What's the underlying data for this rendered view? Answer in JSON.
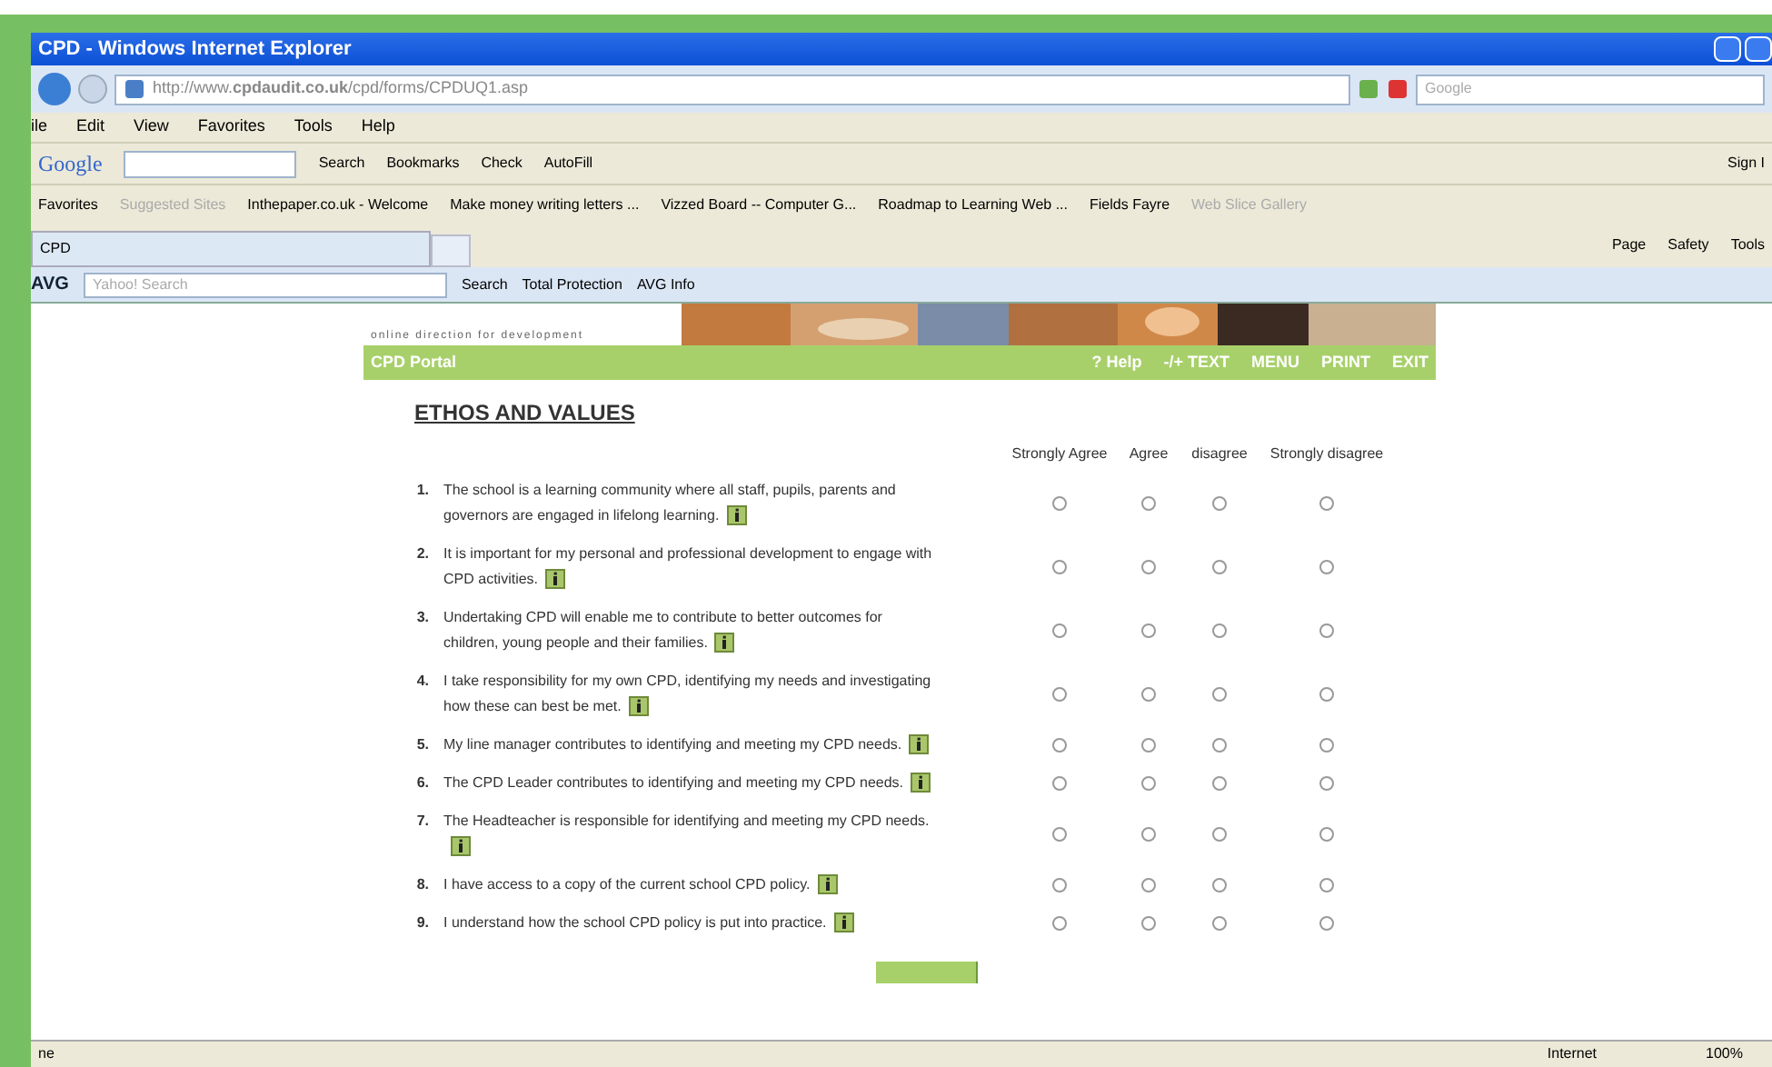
{
  "window": {
    "title": "CPD - Windows Internet Explorer"
  },
  "address": {
    "url": "http://www.**cpdaudit.co.uk**/cpd/forms/CPDUQ1.asp",
    "search_placeholder": "Google"
  },
  "menu": [
    "ile",
    "Edit",
    "View",
    "Favorites",
    "Tools",
    "Help"
  ],
  "google_toolbar": {
    "logo": "Google",
    "items": [
      "Search",
      "Bookmarks",
      "Check",
      "AutoFill"
    ],
    "sign_in": "Sign I"
  },
  "favorites_bar": {
    "label": "Favorites",
    "items": [
      {
        "text": "Suggested Sites",
        "disabled": true
      },
      {
        "text": "Inthepaper.co.uk - Welcome",
        "disabled": false
      },
      {
        "text": "Make money writing letters ...",
        "disabled": false
      },
      {
        "text": "Vizzed Board -- Computer G...",
        "disabled": false
      },
      {
        "text": "Roadmap to Learning Web ...",
        "disabled": false
      },
      {
        "text": "Fields Fayre",
        "disabled": false
      },
      {
        "text": "Web Slice Gallery",
        "disabled": true
      }
    ]
  },
  "tab": {
    "title": "CPD"
  },
  "command_bar": [
    "Page",
    "Safety",
    "Tools"
  ],
  "avg_toolbar": {
    "logo": "AVG",
    "search_placeholder": "Yahoo! Search",
    "items": [
      "Search",
      "Total Protection",
      "AVG Info"
    ]
  },
  "page": {
    "tagline": "online direction for development",
    "portal_bar": {
      "title": "CPD Portal",
      "links": [
        "? Help",
        "-/+ TEXT",
        "MENU",
        "PRINT",
        "EXIT"
      ]
    },
    "heading": "ETHOS AND VALUES",
    "columns": [
      "Strongly Agree",
      "Agree",
      "disagree",
      "Strongly disagree"
    ],
    "questions": [
      {
        "number": "1.",
        "text": "The school is a learning community where all staff, pupils, parents and governors are engaged in lifelong learning.",
        "answers": [
          {
            "selected": false
          },
          {
            "selected": false
          },
          {
            "selected": false
          },
          {
            "selected": false
          }
        ]
      },
      {
        "number": "2.",
        "text": "It is important for my personal and professional development to engage with CPD activities.",
        "answers": [
          {
            "selected": false
          },
          {
            "selected": false
          },
          {
            "selected": false
          },
          {
            "selected": false
          }
        ]
      },
      {
        "number": "3.",
        "text": "Undertaking CPD will enable me to contribute to better outcomes for children, young people and their families.",
        "answers": [
          {
            "selected": false
          },
          {
            "selected": false
          },
          {
            "selected": false
          },
          {
            "selected": false
          }
        ]
      },
      {
        "number": "4.",
        "text": "I take responsibility for my own CPD, identifying my needs and investigating how these can best be met.",
        "answers": [
          {
            "selected": false
          },
          {
            "selected": false
          },
          {
            "selected": false
          },
          {
            "selected": false
          }
        ]
      },
      {
        "number": "5.",
        "text": "My line manager contributes to identifying and meeting my CPD needs.",
        "answers": [
          {
            "selected": false
          },
          {
            "selected": false
          },
          {
            "selected": false
          },
          {
            "selected": false
          }
        ]
      },
      {
        "number": "6.",
        "text": "The CPD Leader contributes to identifying and meeting my CPD needs.",
        "answers": [
          {
            "selected": false
          },
          {
            "selected": false
          },
          {
            "selected": false
          },
          {
            "selected": false
          }
        ]
      },
      {
        "number": "7.",
        "text": "The Headteacher is responsible for identifying and meeting my CPD needs.",
        "answers": [
          {
            "selected": false
          },
          {
            "selected": false
          },
          {
            "selected": false
          },
          {
            "selected": false
          }
        ]
      },
      {
        "number": "8.",
        "text": "I have access to a copy of the current school CPD policy.",
        "answers": [
          {
            "selected": false
          },
          {
            "selected": false
          },
          {
            "selected": false
          },
          {
            "selected": false
          }
        ]
      },
      {
        "number": "9.",
        "text": "I understand how the school CPD policy is put into practice.",
        "answers": [
          {
            "selected": false
          },
          {
            "selected": false
          },
          {
            "selected": false
          },
          {
            "selected": false
          }
        ]
      }
    ]
  },
  "status_bar": {
    "text": "ne",
    "zone": "Internet",
    "zoom": "100%"
  }
}
